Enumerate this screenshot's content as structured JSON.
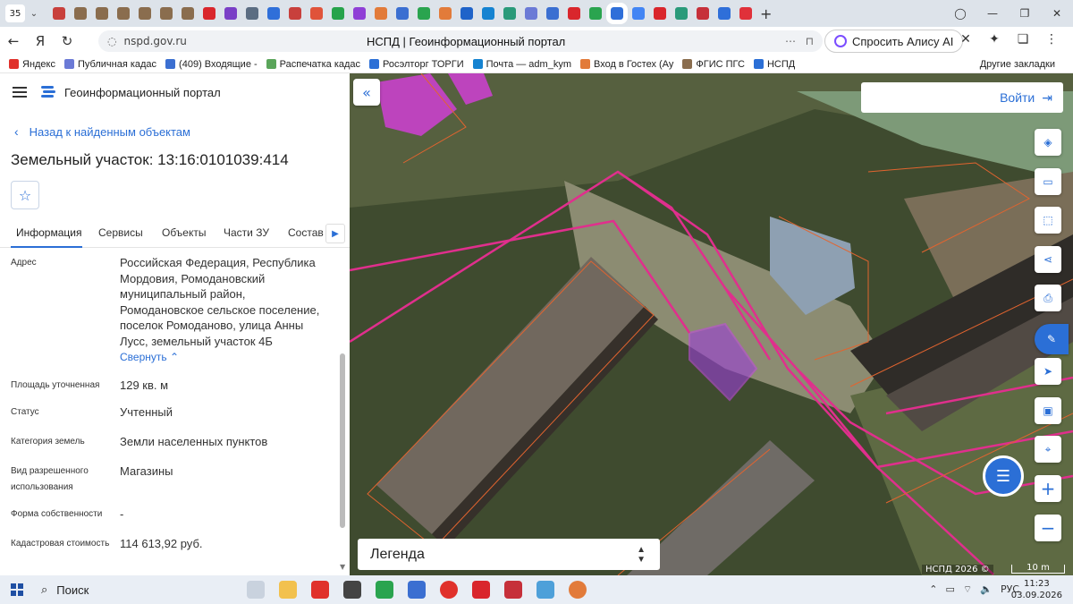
{
  "browser": {
    "tab_count": "35",
    "page_title": "НСПД | Геоинформационный портал",
    "url": "nspd.gov.ru",
    "alice_label": "Спросить Алису AI",
    "bookmarks": [
      "Яндекс",
      "Публичная кадас",
      "(409) Входящие -",
      "Распечатка кадас",
      "Росэлторг ТОРГИ",
      "Почта — adm_kym",
      "Вход в Гостех (Ау",
      "ФГИС ПГС",
      "НСПД"
    ],
    "other_bookmarks": "Другие закладки"
  },
  "panel": {
    "portal_name": "Геоинформационный портал",
    "back_label": "Назад к найденным объектам",
    "object_title": "Земельный участок: 13:16:0101039:414",
    "tabs": [
      "Информация",
      "Сервисы",
      "Объекты",
      "Части ЗУ",
      "Состав"
    ],
    "fields": {
      "address_label": "Адрес",
      "address_value": "Российская Федерация, Республика Мордовия, Ромодановский муниципальный район, Ромодановское сельское поселение, поселок Ромоданово, улица Анны Лусс, земельный участок 4Б",
      "collapse": "Свернуть",
      "area_label": "Площадь уточненная",
      "area_value": "129 кв. м",
      "status_label": "Статус",
      "status_value": "Учтенный",
      "category_label": "Категория земель",
      "category_value": "Земли населенных пунктов",
      "use_label": "Вид разрешенного использования",
      "use_value": "Магазины",
      "ownership_label": "Форма собственности",
      "ownership_value": "-",
      "cost_label": "Кадастровая стоимость",
      "cost_value": "114 613,92 руб."
    }
  },
  "map": {
    "login_label": "Войти",
    "legend_label": "Легенда",
    "copyright": "НСПД 2026 ©",
    "scale_label": "10 m"
  },
  "taskbar": {
    "search_label": "Поиск",
    "lang": "РУС",
    "time": "11:23",
    "date": "03.09.2026"
  }
}
